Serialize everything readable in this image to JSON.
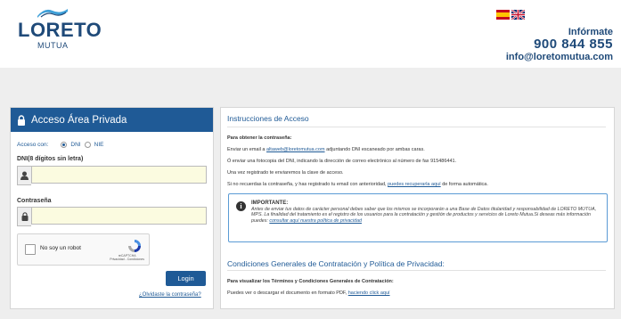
{
  "brand": {
    "name": "LORETO",
    "sub": "MUTUA"
  },
  "languages": [
    {
      "name": "es-flag-icon"
    },
    {
      "name": "uk-flag-icon"
    }
  ],
  "contact": {
    "informate": "Infórmate",
    "phone": "900 844 855",
    "email": "info@loretomutua.com"
  },
  "login": {
    "title": "Acceso Área Privada",
    "access_label": "Acceso con:",
    "options": [
      "DNI",
      "NIE"
    ],
    "selected_option": "DNI",
    "dni_label": "DNI(8 dígitos sin letra)",
    "dni_value": "",
    "password_label": "Contraseña",
    "password_value": "",
    "captcha_label": "No soy un robot",
    "captcha_brand": "reCAPTCHA",
    "captcha_links": "Privacidad - Condiciones",
    "button": "Login",
    "forgot": "¿Olvidaste la contraseña?"
  },
  "instructions": {
    "title": "Instrucciones de Acceso",
    "obtain_heading": "Para obtener la contraseña:",
    "line1_pre": "Enviar un email a ",
    "line1_link": "altaweb@loretomutua.com",
    "line1_post": " adjuntando DNI escaneado por ambas caras.",
    "line2": "Ó enviar una fotocopia del DNI, indicando la dirección de correo electrónico al número de fax 915486441.",
    "line3": "Una vez registrado te enviaremos la clave de acceso.",
    "line4_pre": "Si no recuerdas la contraseña, y has registrado tu email con anterioridad, ",
    "line4_link": "puedes recuperarla aquí",
    "line4_post": " de forma automática.",
    "important_title": "IMPORTANTE:",
    "important_body": "Antes de enviar tus datos de carácter personal debes saber que los mismos se incorporarán a una Base de Datos titularidad y responsabilidad de LORETO MUTUA, MPS. La finalidad del tratamiento es el registro de los usuarios para la contratación y gestión de productos y servicios de Loreto Mutua.Si deseas más información puedes: ",
    "important_link": "consultar aquí nuestra política de privacidad",
    "conditions_title": "Condiciones Generales de Contratación y Política de Privacidad:",
    "conditions_heading": "Para visualizar los Términos y Condiciones Generales de Contratación:",
    "conditions_pre": "Puedes ver o descargar el documento en formato PDF, ",
    "conditions_link": "haciendo click aquí"
  }
}
